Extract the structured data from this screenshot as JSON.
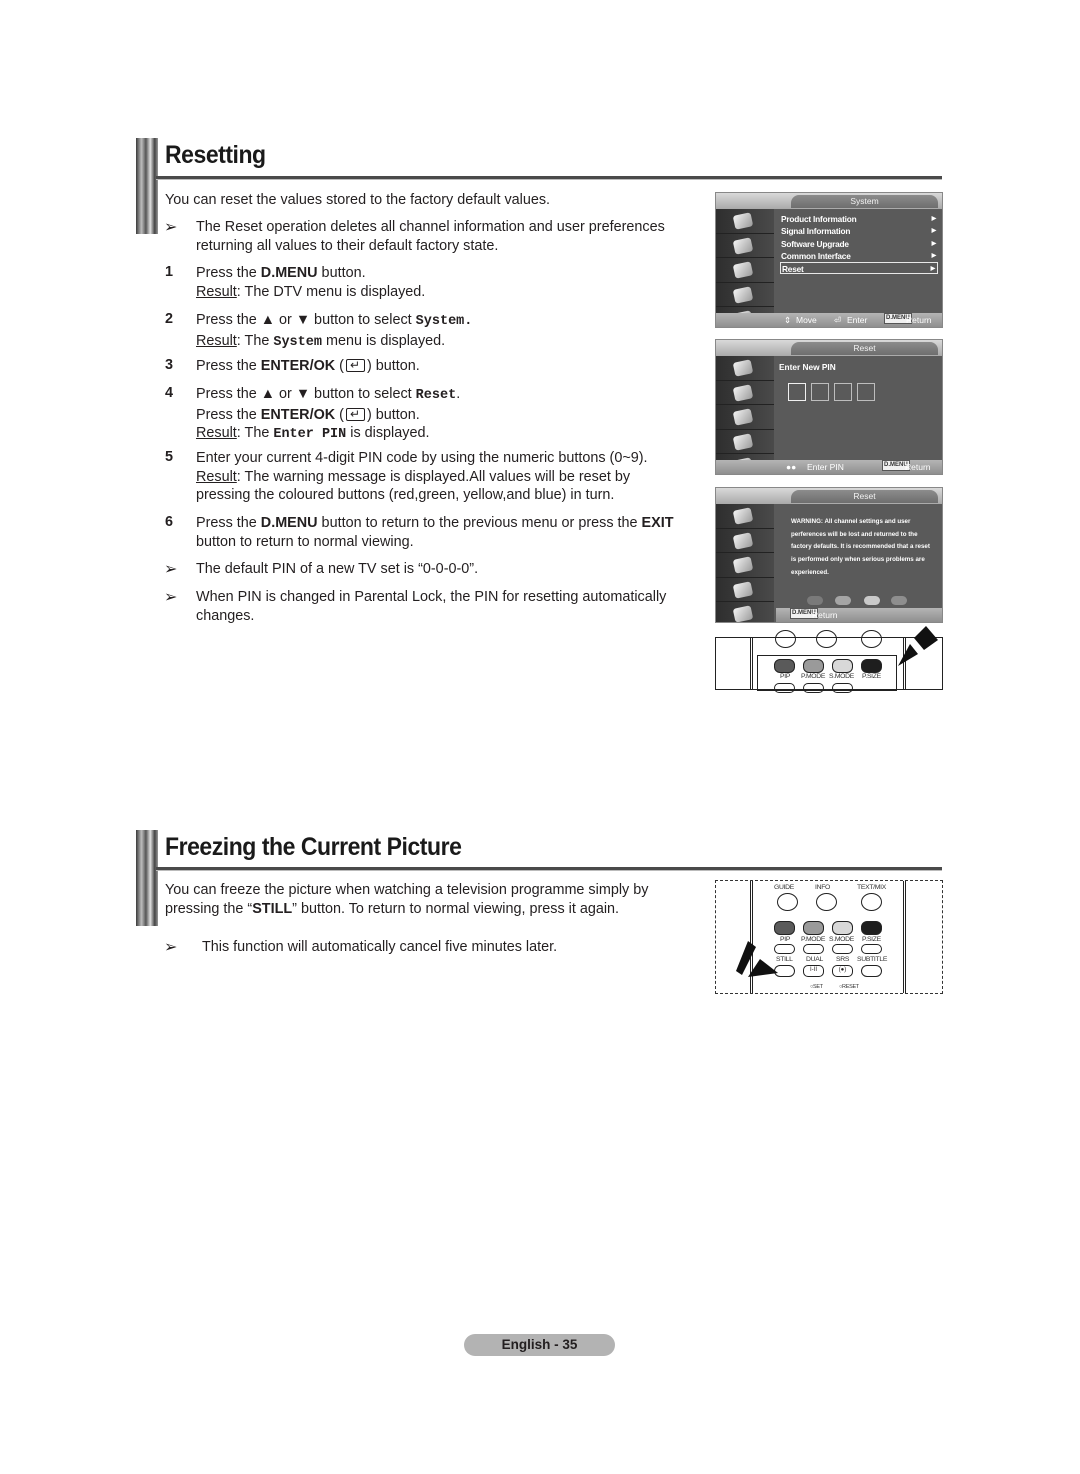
{
  "resetting": {
    "title": "Resetting",
    "intro": "You can reset the values stored to the factory default values.",
    "note1_a": "The Reset operation deletes all channel information and user preferences",
    "note1_b": "returning all values to their default factory state.",
    "steps": [
      {
        "num": "1",
        "l1_pre": "Press the ",
        "l1_bold": "D.MENU",
        "l1_post": " button.",
        "result_label": "Result",
        "result_text": ": The DTV menu is displayed."
      },
      {
        "num": "2",
        "l1_pre": "Press the ▲ or ▼ button to select ",
        "l1_mono": "System.",
        "result_label": "Result",
        "result_pre": ": The ",
        "result_mono": "System",
        "result_post": " menu is displayed."
      },
      {
        "num": "3",
        "l1_pre": "Press the ",
        "l1_bold": "ENTER/OK",
        "l1_post_a": " (",
        "l1_post_b": ") button."
      },
      {
        "num": "4",
        "l1_pre": "Press the ▲ or ▼ button to select ",
        "l1_mono": "Reset",
        "l1_post": ".",
        "l2_pre": "Press the ",
        "l2_bold": "ENTER/OK",
        "l2_post_a": " (",
        "l2_post_b": ") button.",
        "result_label": "Result",
        "result_pre": ": The ",
        "result_mono": "Enter PIN",
        "result_post": " is displayed."
      },
      {
        "num": "5",
        "l1": "Enter your current 4-digit PIN code by using the numeric buttons (0~9).",
        "result_label": "Result",
        "result_text": ": The warning message is displayed.All values will be reset by",
        "l3": "pressing the coloured buttons (red,green, yellow,and blue) in turn."
      },
      {
        "num": "6",
        "l1_pre": "Press the ",
        "l1_bold": "D.MENU",
        "l1_mid": " button to return to the previous menu or press the ",
        "l1_bold2": "EXIT",
        "l2": "button to return to normal viewing."
      }
    ],
    "note2": "The default PIN of a new TV set is “0-0-0-0”.",
    "note3_a": "When PIN is changed in Parental Lock, the PIN for resetting automatically",
    "note3_b": "changes."
  },
  "osd_system": {
    "header": "System",
    "items": [
      "Product Information",
      "Signal Information",
      "Software Upgrade",
      "Common Interface",
      "Reset"
    ],
    "selected": "Reset",
    "footer": {
      "move": "Move",
      "enter": "Enter",
      "dmenu": "D.MENU",
      "return": "Return"
    }
  },
  "osd_pin": {
    "header": "Reset",
    "label": "Enter New PIN",
    "footer": {
      "enter_pin": "Enter PIN",
      "dmenu": "D.MENU",
      "return": "Return"
    }
  },
  "osd_warning": {
    "header": "Reset",
    "warning": "WARNING: All channel settings and user perferences will be lost and returned to the factory defaults. It is recommended that a reset is performed only when serious problems are experienced.",
    "colors": [
      "#7a7a7a",
      "#a5a5a5",
      "#c9c9c9",
      "#8e8e8e"
    ],
    "footer": {
      "dmenu": "D.MENU",
      "return": "Return"
    }
  },
  "remote1": {
    "labels": [
      "PIP",
      "P.MODE",
      "S.MODE",
      "P.SIZE"
    ],
    "colors": [
      "#5a5a5a",
      "#9a9a9a",
      "#d8d8d8",
      "#1e1e1e"
    ]
  },
  "freezing": {
    "title": "Freezing the Current Picture",
    "intro_a": "You can freeze the picture when watching a television programme simply by",
    "intro_b_pre": "pressing the “",
    "intro_b_bold": "STILL",
    "intro_b_post": "” button. To return to normal viewing, press it again.",
    "note": "This function will automatically cancel five minutes later."
  },
  "remote2": {
    "top_labels": [
      "GUIDE",
      "INFO",
      "TEXT/MIX"
    ],
    "mid_labels": [
      "PIP",
      "P.MODE",
      "S.MODE",
      "P.SIZE"
    ],
    "bot_labels": [
      "STILL",
      "DUAL",
      "SRS",
      "SUBTITLE"
    ],
    "dual_glyph": "I-II",
    "srs_glyph": "(●)",
    "set_label": "SET",
    "reset_label": "RESET",
    "colors": [
      "#5a5a5a",
      "#9a9a9a",
      "#d8d8d8",
      "#1e1e1e"
    ]
  },
  "footer": {
    "page": "English - 35"
  }
}
